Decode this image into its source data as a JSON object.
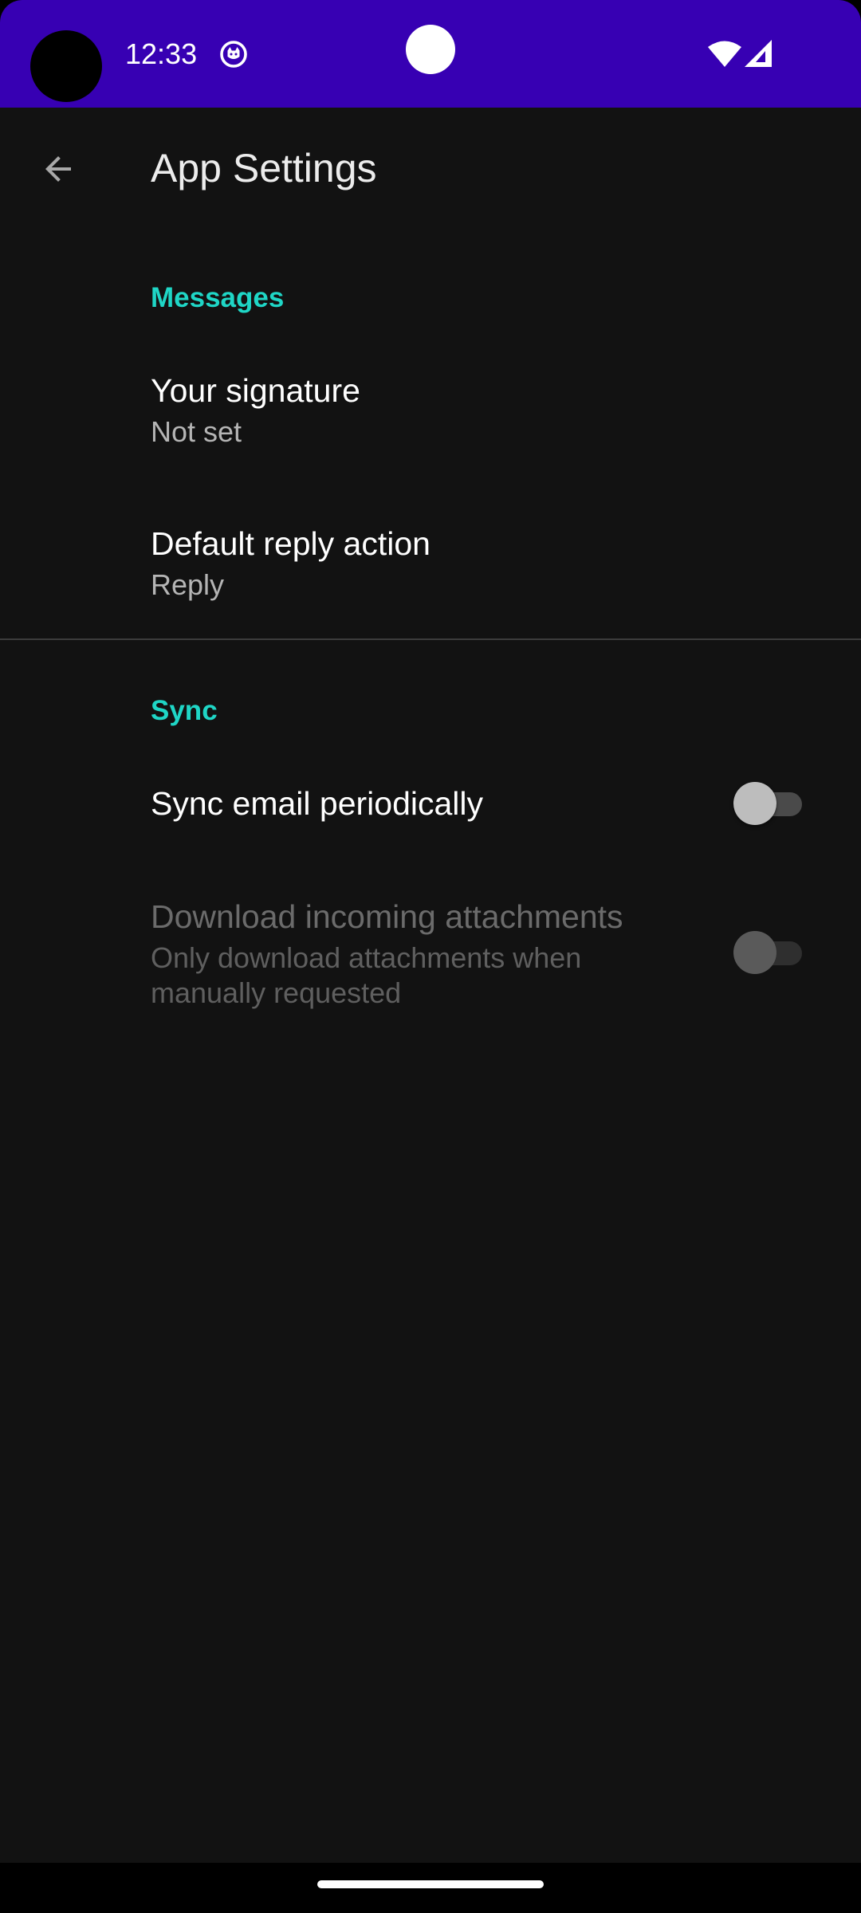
{
  "status_bar": {
    "time": "12:33",
    "background_color": "#3700b3",
    "icons": [
      "notification-app-icon",
      "wifi-icon",
      "cell-signal-icon"
    ]
  },
  "app_bar": {
    "title": "App Settings",
    "back_icon": "arrow-back-icon"
  },
  "categories": {
    "messages": {
      "title": "Messages",
      "items": [
        {
          "title": "Your signature",
          "summary": "Not set"
        },
        {
          "title": "Default reply action",
          "summary": "Reply"
        }
      ]
    },
    "sync": {
      "title": "Sync",
      "items": [
        {
          "title": "Sync email periodically",
          "checked": false,
          "enabled": true
        },
        {
          "title": "Download incoming attachments",
          "summary": "Only download attachments when manually requested",
          "checked": false,
          "enabled": false
        }
      ]
    }
  },
  "colors": {
    "accent": "#1fd6c6",
    "background": "#121212",
    "text_primary": "#ffffff",
    "text_secondary": "#b5b5b5"
  }
}
